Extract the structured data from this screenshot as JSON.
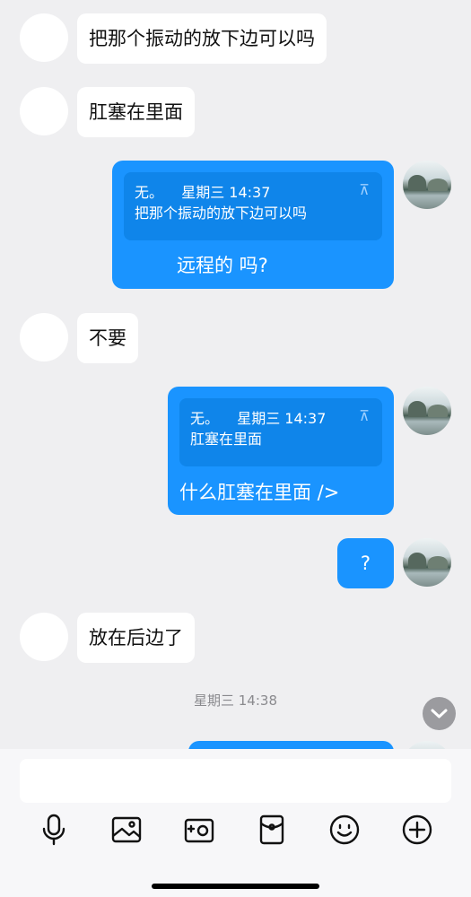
{
  "messages": [
    {
      "side": "left",
      "text": "把那个振动的放下边可以吗"
    },
    {
      "side": "left",
      "text": "肛塞在里面"
    },
    {
      "side": "right",
      "quote_sender": "无。",
      "quote_time": "星期三 14:37",
      "quote_text": "把那个振动的放下边可以吗",
      "text": "远程的 吗?"
    },
    {
      "side": "left",
      "text": "不要"
    },
    {
      "side": "right",
      "quote_sender": "无。",
      "quote_time": "星期三 14:37",
      "quote_text": "肛塞在里面",
      "text": "什么肛塞在里面 />"
    },
    {
      "side": "right",
      "text": "?"
    },
    {
      "side": "left",
      "text": "放在后边了"
    }
  ],
  "timestamp": "星期三 14:38",
  "quote_arrow_glyph": "⊼",
  "icons": {
    "scroll_down": "chevron-down-icon",
    "toolbar": [
      "microphone-icon",
      "image-icon",
      "camera-icon",
      "red-packet-icon",
      "emoji-icon",
      "plus-icon"
    ]
  },
  "colors": {
    "background": "#efeff1",
    "bubble_self": "#1a94ff",
    "bubble_other": "#ffffff",
    "input_bar": "#f7f7f9"
  }
}
